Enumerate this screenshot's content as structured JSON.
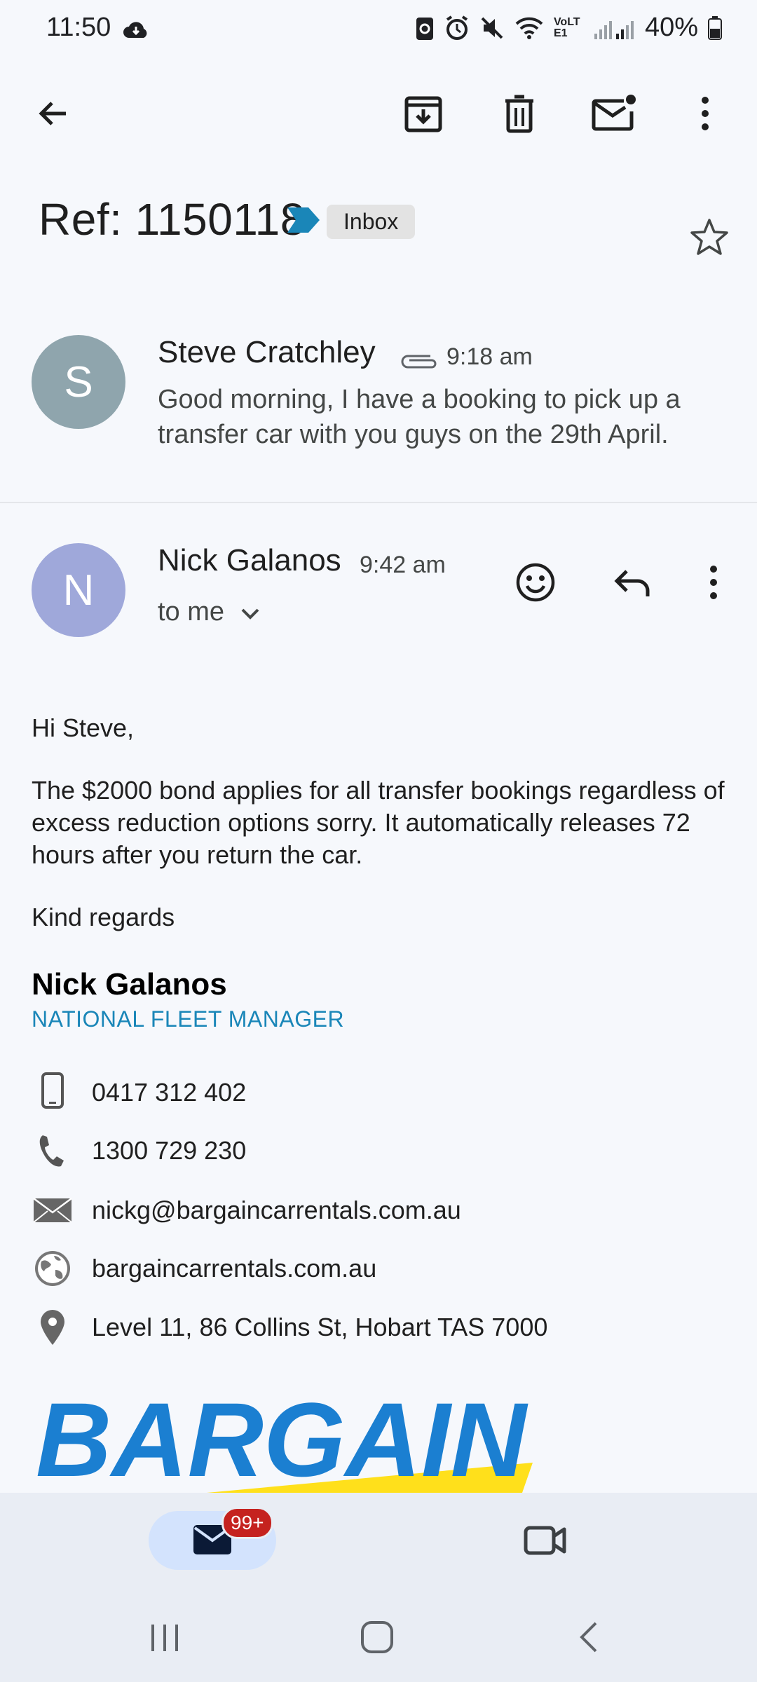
{
  "status": {
    "time": "11:50",
    "battery": "40%",
    "network": "VoLTE1"
  },
  "toolbar": {
    "back": "arrow-back-icon",
    "archive": "archive-icon",
    "delete": "delete-icon",
    "mark_unread": "mark-unread-icon",
    "more": "more-vert-icon"
  },
  "thread": {
    "subject": "Ref: 1150118",
    "label": "Inbox",
    "label_color": "#1a86b8"
  },
  "messages": [
    {
      "avatar_letter": "S",
      "avatar_color": "#8fa5ad",
      "sender": "Steve Cratchley",
      "time": "9:18 am",
      "snippet": "Good morning, I have a booking to pick up a transfer car with you guys on the 29th April."
    },
    {
      "avatar_letter": "N",
      "avatar_color": "#9fa8da",
      "sender": "Nick Galanos",
      "time": "9:42 am",
      "recipient": "to me",
      "greeting": "Hi Steve,",
      "body": "The $2000 bond applies for all transfer bookings regardless of excess reduction options sorry. It automatically releases 72 hours after you return the car.",
      "closing": "Kind regards",
      "signature": {
        "name": "Nick Galanos",
        "title": "NATIONAL FLEET MANAGER",
        "mobile": "0417 312 402",
        "phone": "1300 729 230",
        "email": "nickg@bargaincarrentals.com.au",
        "website": "bargaincarrentals.com.au",
        "address": "Level 11, 86 Collins St, Hobart TAS 7000",
        "logo_text": "BARGAIN"
      }
    }
  ],
  "bottom_nav": {
    "mail_badge": "99+"
  },
  "colors": {
    "background": "#f6f8fc",
    "accent_blue": "#1a86b8",
    "badge_red": "#c5221f",
    "logo_blue": "#1b7fd1",
    "logo_yellow": "#ffe01b"
  }
}
